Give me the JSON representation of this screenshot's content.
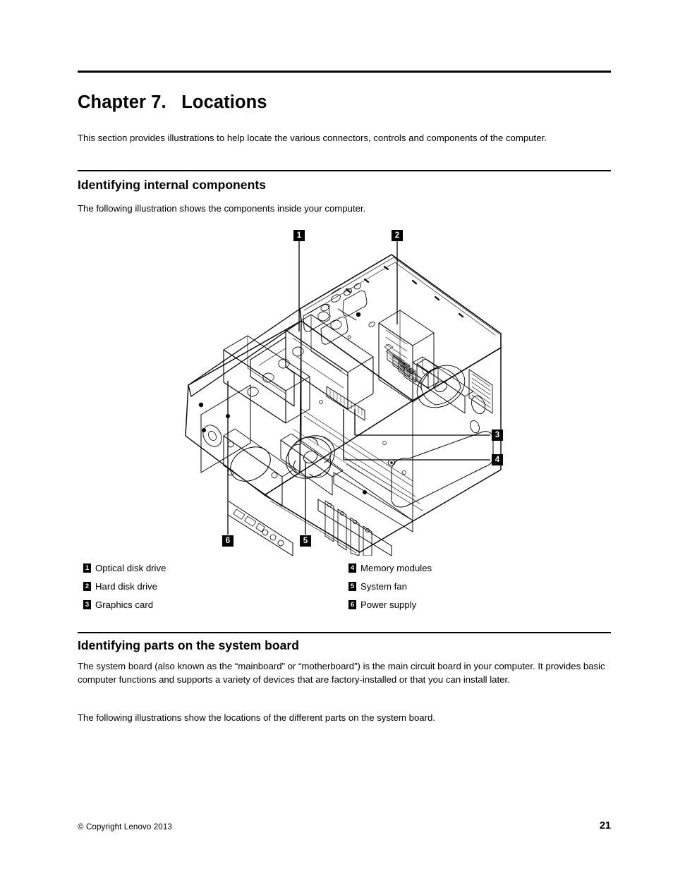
{
  "document": {
    "chapter_title": "Chapter 7.   Locations",
    "intro_paragraph": "This section provides illustrations to help locate the various connectors, controls and components of the computer."
  },
  "sections": [
    {
      "heading": "Identifying internal components",
      "intro": "The following illustration shows the components inside your computer."
    },
    {
      "heading": "Identifying parts on the system board",
      "paragraph_1": "The system board (also known as the “mainboard” or “motherboard”) is the main circuit board in your computer. It provides basic computer functions and supports a variety of devices that are factory-installed or that you can install later.",
      "paragraph_2": "The following illustrations show the locations of the different parts on the system board."
    }
  ],
  "figure": {
    "alt": "Isometric cutaway line drawing of desktop computer chassis interior",
    "callouts": [
      {
        "number": "1",
        "target": "Optical disk drive"
      },
      {
        "number": "2",
        "target": "Hard disk drive"
      },
      {
        "number": "3",
        "target": "Graphics card"
      },
      {
        "number": "4",
        "target": "Memory modules"
      },
      {
        "number": "5",
        "target": "System fan"
      },
      {
        "number": "6",
        "target": "Power supply"
      }
    ]
  },
  "legend": {
    "left_column": [
      {
        "number": "1",
        "label": "Optical disk drive"
      },
      {
        "number": "2",
        "label": "Hard disk drive"
      },
      {
        "number": "3",
        "label": "Graphics card"
      }
    ],
    "right_column": [
      {
        "number": "4",
        "label": "Memory modules"
      },
      {
        "number": "5",
        "label": "System fan"
      },
      {
        "number": "6",
        "label": "Power supply"
      }
    ]
  },
  "footer": {
    "copyright": "© Copyright Lenovo 2013",
    "page_number": "21"
  },
  "colors": {
    "ink": "#000000",
    "paper": "#ffffff"
  }
}
